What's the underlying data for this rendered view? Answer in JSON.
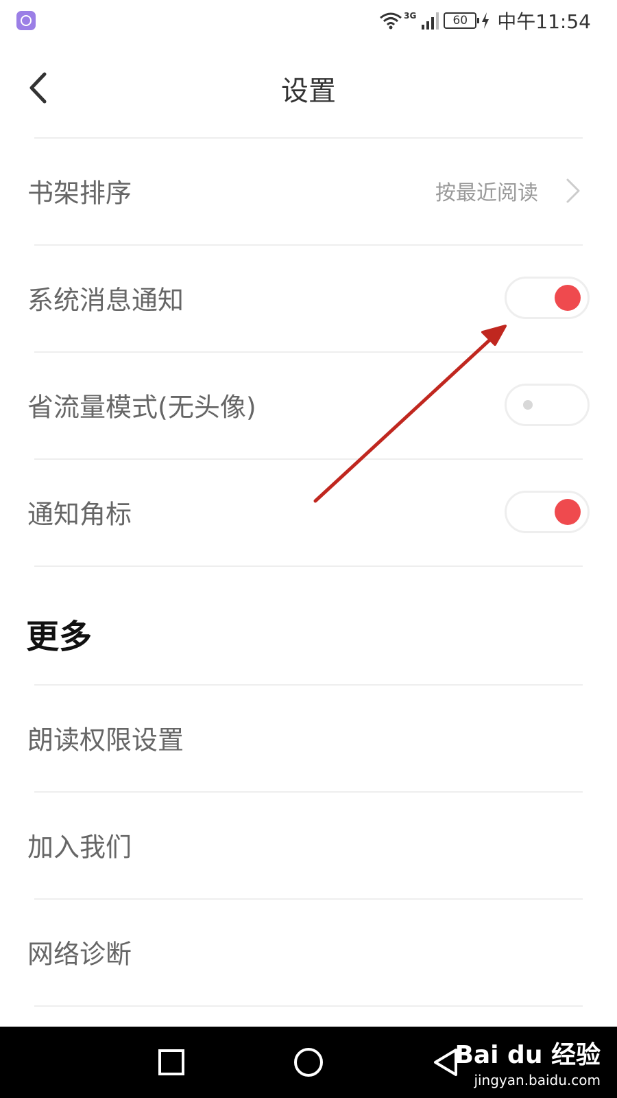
{
  "status_bar": {
    "network_type": "3G",
    "battery": "60",
    "time": "中午11:54"
  },
  "header": {
    "title": "设置"
  },
  "settings": {
    "shelf_sort": {
      "label": "书架排序",
      "value": "按最近阅读"
    },
    "system_notification": {
      "label": "系统消息通知",
      "state": "on"
    },
    "data_saving": {
      "label": "省流量模式(无头像)",
      "state": "off"
    },
    "badge": {
      "label": "通知角标",
      "state": "on"
    }
  },
  "more": {
    "title": "更多",
    "items": [
      {
        "label": "朗读权限设置"
      },
      {
        "label": "加入我们"
      },
      {
        "label": "网络诊断"
      }
    ]
  },
  "watermark": {
    "logo": "Bai du 经验",
    "url": "jingyan.baidu.com"
  },
  "colors": {
    "accent": "#ef4a4e",
    "annotation": "#c0271f",
    "divider": "#eeeeee"
  }
}
